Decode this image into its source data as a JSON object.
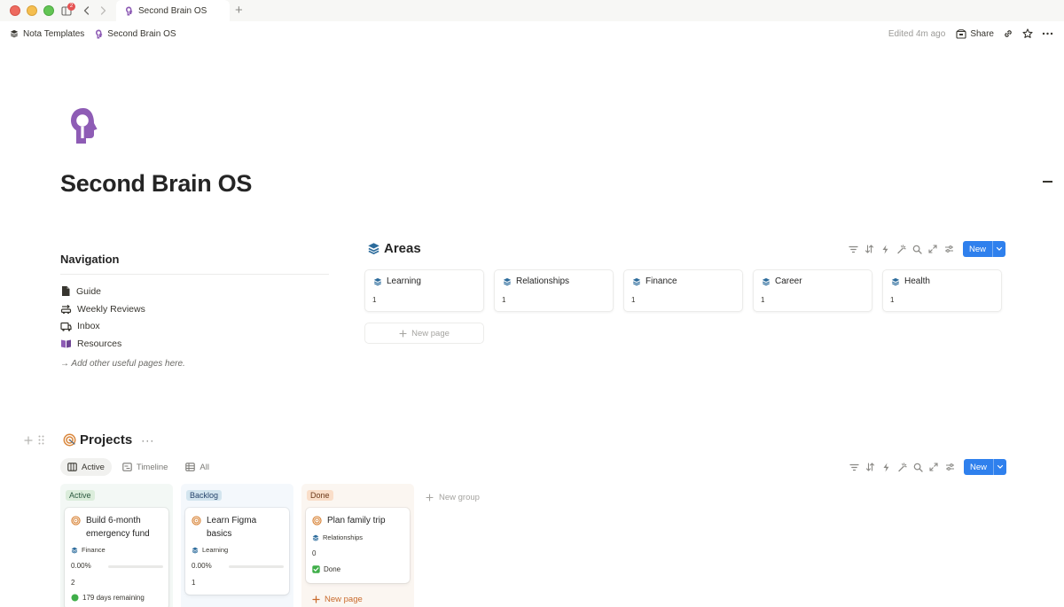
{
  "window": {
    "tab_count_badge": "2",
    "tab_title": "Second Brain OS"
  },
  "topbar": {
    "breadcrumbs": [
      {
        "label": "Nota Templates",
        "icon": "layers-icon"
      },
      {
        "label": "Second Brain OS",
        "icon": "brain-head-icon"
      }
    ],
    "edited": "Edited 4m ago",
    "share_label": "Share"
  },
  "page": {
    "icon": "brain-head-icon",
    "icon_color": "#8e5cb5",
    "title": "Second Brain OS"
  },
  "navigation": {
    "heading": "Navigation",
    "items": [
      {
        "label": "Guide",
        "icon": "document-icon"
      },
      {
        "label": "Weekly Reviews",
        "icon": "car-swap-icon"
      },
      {
        "label": "Inbox",
        "icon": "inbox-truck-icon"
      },
      {
        "label": "Resources",
        "icon": "book-icon"
      }
    ],
    "note": "→ Add other useful pages here."
  },
  "areas": {
    "title": "Areas",
    "new_label": "New",
    "new_page_label": "New page",
    "cards": [
      {
        "name": "Learning",
        "value": "1"
      },
      {
        "name": "Relationships",
        "value": "1"
      },
      {
        "name": "Finance",
        "value": "1"
      },
      {
        "name": "Career",
        "value": "1"
      },
      {
        "name": "Health",
        "value": "1"
      }
    ]
  },
  "projects": {
    "title": "Projects",
    "more": "···",
    "new_label": "New",
    "tabs": [
      {
        "label": "Active",
        "icon": "board-icon",
        "active": true
      },
      {
        "label": "Timeline",
        "icon": "timeline-icon",
        "active": false
      },
      {
        "label": "All",
        "icon": "table-icon",
        "active": false
      }
    ],
    "new_group_label": "New group",
    "columns": [
      {
        "label": "Active",
        "cards": [
          {
            "title": "Build 6-month emergency fund",
            "area": "Finance",
            "progress": "0.00%",
            "progress_fraction": 0,
            "count": "2",
            "status": "179 days remaining",
            "status_icon": "green-circle-icon"
          }
        ]
      },
      {
        "label": "Backlog",
        "cards": [
          {
            "title": "Learn Figma basics",
            "area": "Learning",
            "progress": "0.00%",
            "progress_fraction": 0,
            "count": "1"
          }
        ]
      },
      {
        "label": "Done",
        "cards": [
          {
            "title": "Plan family trip",
            "area": "Relationships",
            "count": "0",
            "status": "Done",
            "status_icon": "green-check-icon"
          }
        ],
        "new_page_label": "New page"
      }
    ]
  },
  "colors": {
    "accent_blue": "#2f80ed",
    "purple": "#8e5cb5",
    "layers_blue": "#2d6c9c",
    "target_orange": "#d9863b",
    "done_orange": "#c96a2c"
  }
}
